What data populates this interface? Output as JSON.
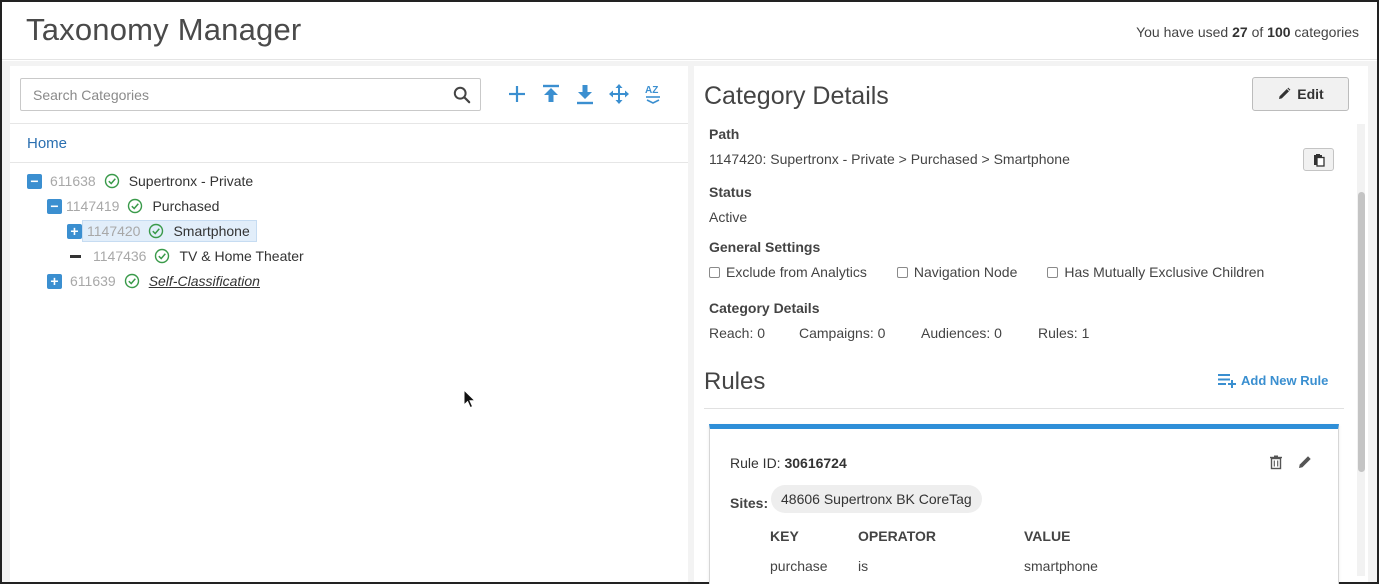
{
  "header": {
    "title": "Taxonomy Manager",
    "usage_prefix": "You have used",
    "usage_used": "27",
    "usage_of": "of",
    "usage_total": "100",
    "usage_suffix": "categories"
  },
  "search": {
    "placeholder": "Search Categories",
    "value": "",
    "icon": "search-icon"
  },
  "toolbar": {
    "icons": [
      "add-icon",
      "upload-icon",
      "download-icon",
      "move-icon",
      "sort-az-icon"
    ],
    "sort_label": "AZ"
  },
  "breadcrumb": {
    "home": "Home"
  },
  "tree": [
    {
      "id": "611638",
      "label": "Supertronx - Private",
      "toggle": "−",
      "status": "active"
    },
    {
      "id": "1147419",
      "label": "Purchased",
      "toggle": "−",
      "status": "active"
    },
    {
      "id": "1147420",
      "label": "Smartphone",
      "toggle": "+",
      "status": "active",
      "selected": true
    },
    {
      "id": "1147436",
      "label": "TV & Home Theater",
      "toggle": "",
      "status": "active"
    },
    {
      "id": "611639",
      "label": "Self-Classification",
      "toggle": "+",
      "status": "active"
    }
  ],
  "details": {
    "title": "Category Details",
    "edit_label": "Edit",
    "path_label": "Path",
    "path_value": "1147420: Supertronx - Private > Purchased > Smartphone",
    "status_label": "Status",
    "status_value": "Active",
    "general_label": "General Settings",
    "settings": [
      {
        "label": "Exclude from Analytics",
        "checked": false
      },
      {
        "label": "Navigation Node",
        "checked": false
      },
      {
        "label": "Has Mutually Exclusive Children",
        "checked": false
      }
    ],
    "category_details_label": "Category Details",
    "stats": {
      "reach": "Reach: 0",
      "campaigns": "Campaigns: 0",
      "audiences": "Audiences: 0",
      "rules": "Rules: 1"
    }
  },
  "rules": {
    "title": "Rules",
    "add_label": "Add New Rule",
    "card": {
      "rule_id_label": "Rule ID:",
      "rule_id_value": "30616724",
      "sites_label": "Sites:",
      "site_chip": "48606 Supertronx BK CoreTag",
      "columns": [
        "KEY",
        "OPERATOR",
        "VALUE"
      ],
      "row": [
        "purchase",
        "is",
        "smartphone"
      ]
    }
  },
  "colors": {
    "accent": "#3b8fd0",
    "link": "#2a6fb0",
    "check": "#3a9a4a",
    "rule_top": "#2f8fd8"
  }
}
